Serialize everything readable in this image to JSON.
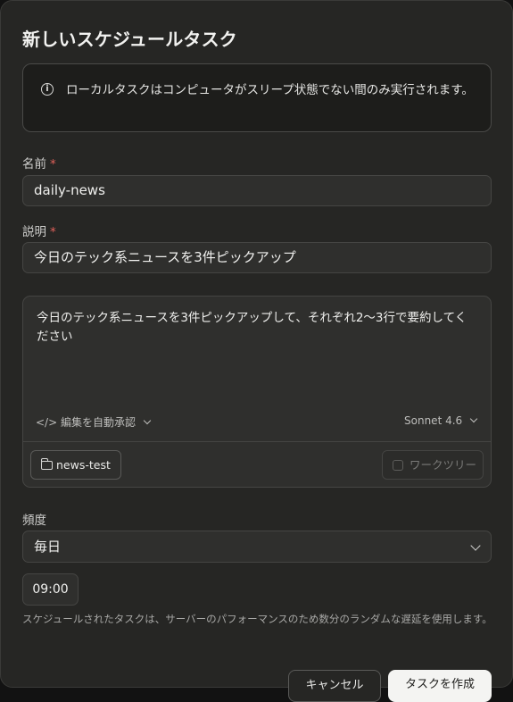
{
  "dialog": {
    "title": "新しいスケジュールタスク",
    "info_text": "ローカルタスクはコンピュータがスリープ状態でない間のみ実行されます。",
    "info_icon": "info-icon"
  },
  "form": {
    "name_label": "名前",
    "name_value": "daily-news",
    "description_label": "説明",
    "description_value": "今日のテック系ニュースを3件ピックアップ",
    "required_marker": "*",
    "prompt_value": "今日のテック系ニュースを3件ピックアップして、それぞれ2〜3行で要約してください",
    "auto_approve_label": "編集を自動承認",
    "model_label": "Sonnet 4.6",
    "folder_label": "news-test",
    "worktree_label": "ワークツリー",
    "frequency_label": "頻度",
    "frequency_value": "毎日",
    "time_value": "09:00",
    "note": "スケジュールされたタスクは、サーバーのパフォーマンスのため数分のランダムな遅延を使用します。"
  },
  "footer": {
    "cancel_label": "キャンセル",
    "create_label": "タスクを作成"
  },
  "colors": {
    "background": "#262624",
    "required": "#e0605a",
    "primary_button": "#f4f4f2"
  }
}
